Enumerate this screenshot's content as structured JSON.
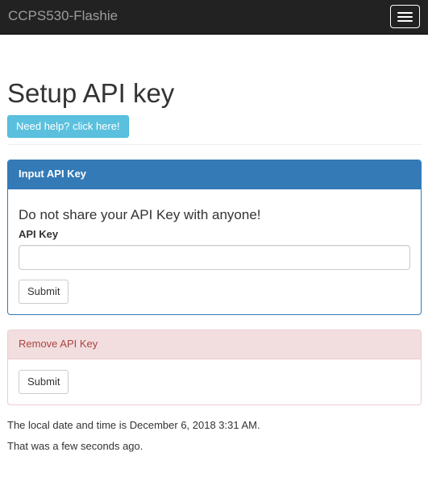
{
  "navbar": {
    "brand": "CCPS530-Flashie",
    "toggle_icon": "hamburger-menu-icon"
  },
  "page": {
    "title": "Setup API key",
    "help_button": "Need help? click here!"
  },
  "input_panel": {
    "heading": "Input API Key",
    "warning": "Do not share your API Key with anyone!",
    "field_label": "API Key",
    "field_value": "",
    "field_placeholder": "",
    "submit_label": "Submit"
  },
  "remove_panel": {
    "heading": "Remove API Key",
    "submit_label": "Submit"
  },
  "footer": {
    "datetime_text": "The local date and time is December 6, 2018 3:31 AM.",
    "relative_text": "That was a few seconds ago."
  },
  "colors": {
    "navbar_bg": "#222222",
    "info_button": "#5bc0de",
    "primary_panel": "#337ab7",
    "danger_heading_bg": "#f2dede",
    "danger_heading_text": "#a94442"
  }
}
